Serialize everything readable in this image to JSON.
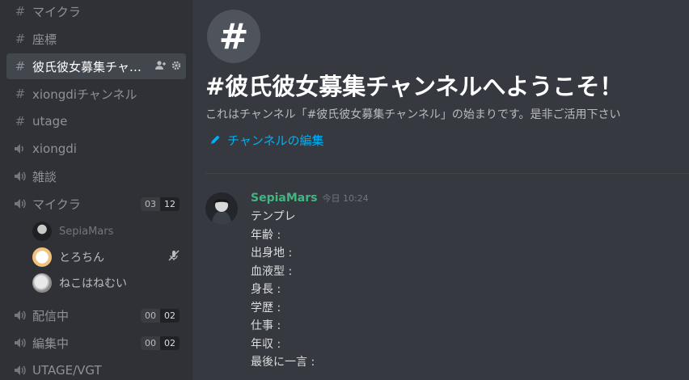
{
  "sidebar": {
    "channels": [
      {
        "type": "text",
        "label": "マイクラ"
      },
      {
        "type": "text",
        "label": "座標"
      },
      {
        "type": "text",
        "label": "彼氏彼女募集チャ…",
        "active": true
      },
      {
        "type": "text",
        "label": "xiongdiチャンネル"
      },
      {
        "type": "text",
        "label": "utage"
      },
      {
        "type": "voice",
        "label": "xiongdi"
      },
      {
        "type": "voice",
        "label": "雑談"
      },
      {
        "type": "voice",
        "label": "マイクラ",
        "count": "03",
        "limit": "12"
      },
      {
        "type": "voice",
        "label": "配信中",
        "count": "00",
        "limit": "02"
      },
      {
        "type": "voice",
        "label": "編集中",
        "count": "00",
        "limit": "02"
      },
      {
        "type": "voice",
        "label": "UTAGE/VGT"
      }
    ],
    "voice_users": [
      {
        "name": "SepiaMars",
        "muted": false
      },
      {
        "name": "とろちん",
        "muted": true
      },
      {
        "name": "ねこはねむい",
        "muted": false
      }
    ]
  },
  "main": {
    "hero_symbol": "#",
    "welcome_title": "#彼氏彼女募集チャンネルへようこそ！",
    "welcome_sub": "これはチャンネル「#彼氏彼女募集チャンネル」の始まりです。是非ご活用下さい",
    "edit_label": "チャンネルの編集",
    "message": {
      "author": "SepiaMars",
      "timestamp": "今日 10:24",
      "lines": [
        "テンプレ",
        "年齢 :",
        "出身地 :",
        "血液型 :",
        "身長 :",
        "学歴 :",
        "仕事 :",
        "年収 :",
        "最後に一言 :"
      ]
    }
  },
  "colors": {
    "accent": "#00b0f4",
    "author": "#43b581",
    "sidebar_bg": "#2f3136",
    "main_bg": "#36393f"
  }
}
